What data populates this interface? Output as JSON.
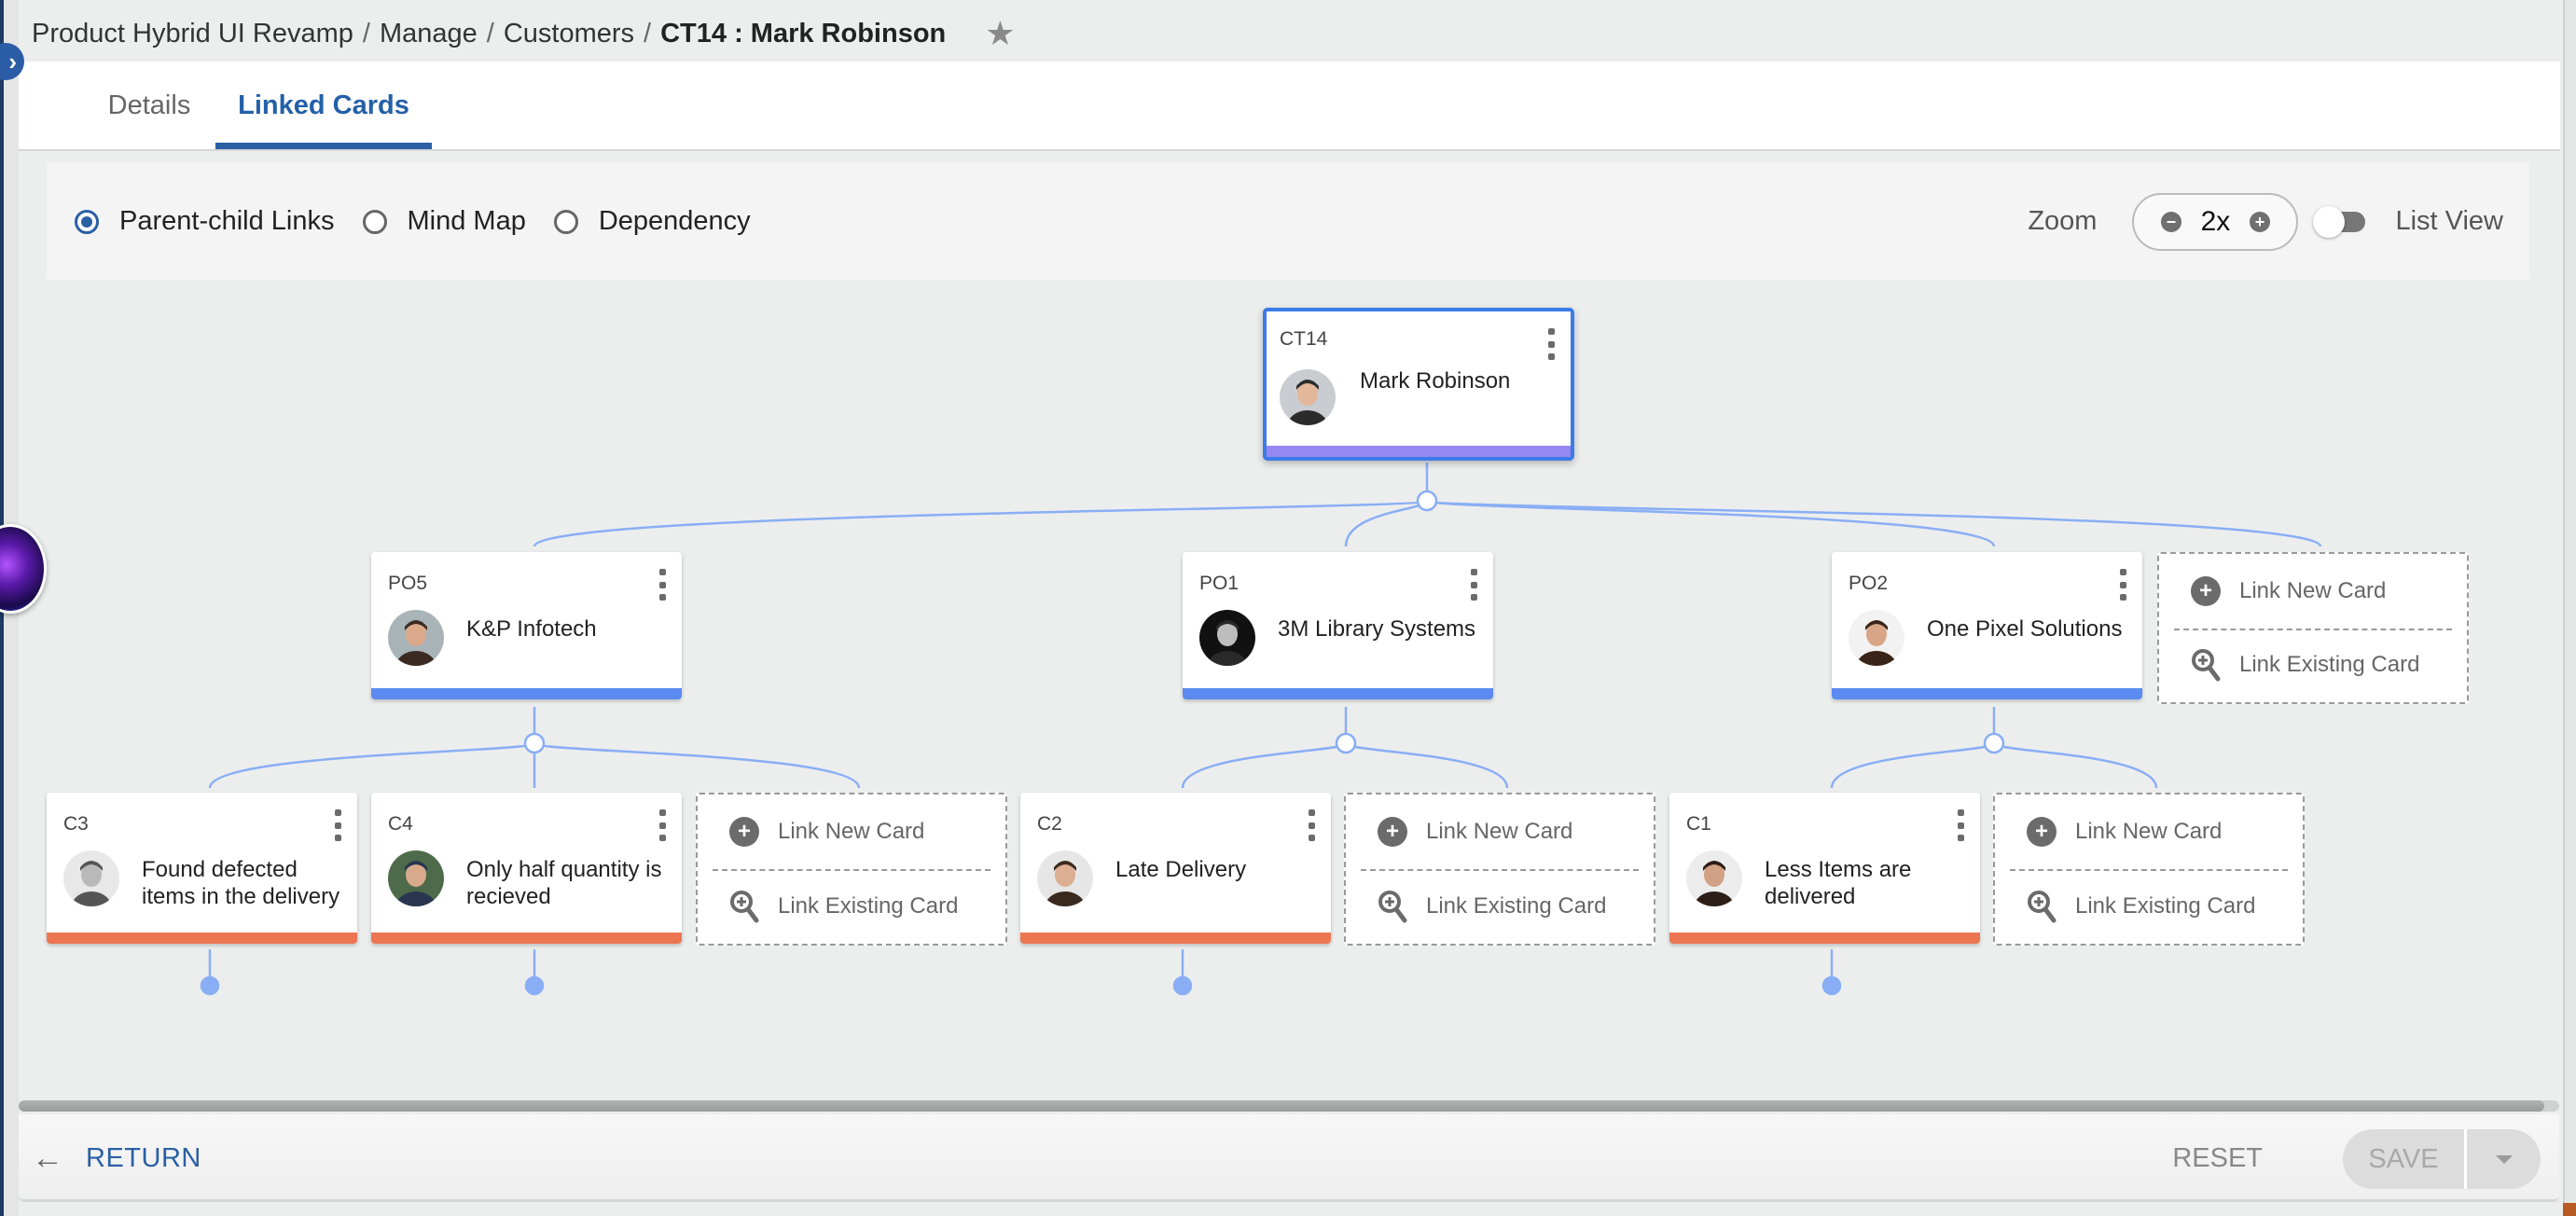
{
  "breadcrumb": {
    "items": [
      "Product Hybrid UI Revamp",
      "Manage",
      "Customers"
    ],
    "separator": "/",
    "current": "CT14 : Mark Robinson"
  },
  "tabs": [
    {
      "label": "Details",
      "active": false
    },
    {
      "label": "Linked Cards",
      "active": true
    }
  ],
  "view_options": {
    "radios": [
      {
        "label": "Parent-child Links",
        "checked": true
      },
      {
        "label": "Mind Map",
        "checked": false
      },
      {
        "label": "Dependency",
        "checked": false
      }
    ],
    "zoom_label": "Zoom",
    "zoom_minus": "−",
    "zoom_value": "2x",
    "zoom_plus": "+",
    "list_view_label": "List View",
    "list_view_on": false
  },
  "colors": {
    "accent": "#2a5fa4",
    "root_border": "#3b7be8",
    "root_bar": "#9688f2",
    "po_bar": "#5b8af0",
    "case_bar": "#ec7652",
    "connector": "#8aaef5"
  },
  "tree": {
    "root": {
      "id": "CT14",
      "title": "Mark Robinson",
      "avatar": "avatar-man-glasses"
    },
    "level1": [
      {
        "id": "PO5",
        "title": "K&P Infotech",
        "avatar": "avatar-man-grey-suit"
      },
      {
        "id": "PO1",
        "title": "3M Library Systems",
        "avatar": "avatar-man-cap-bw"
      },
      {
        "id": "PO2",
        "title": "One Pixel Solutions",
        "avatar": "avatar-woman-curly-hair"
      }
    ],
    "level2": [
      {
        "id": "C3",
        "title": "Found defected items in the delivery",
        "avatar": "avatar-man-bw"
      },
      {
        "id": "C4",
        "title": "Only half quantity is recieved",
        "avatar": "avatar-man-blue-suit"
      },
      {
        "id": "C2",
        "title": "Late Delivery",
        "avatar": "avatar-man-beard"
      },
      {
        "id": "C1",
        "title": "Less Items are delivered",
        "avatar": "avatar-man-beard-dark"
      }
    ],
    "link_new_label": "Link New Card",
    "link_existing_label": "Link Existing Card"
  },
  "footer": {
    "return_label": "RETURN",
    "reset_label": "RESET",
    "save_label": "SAVE"
  }
}
